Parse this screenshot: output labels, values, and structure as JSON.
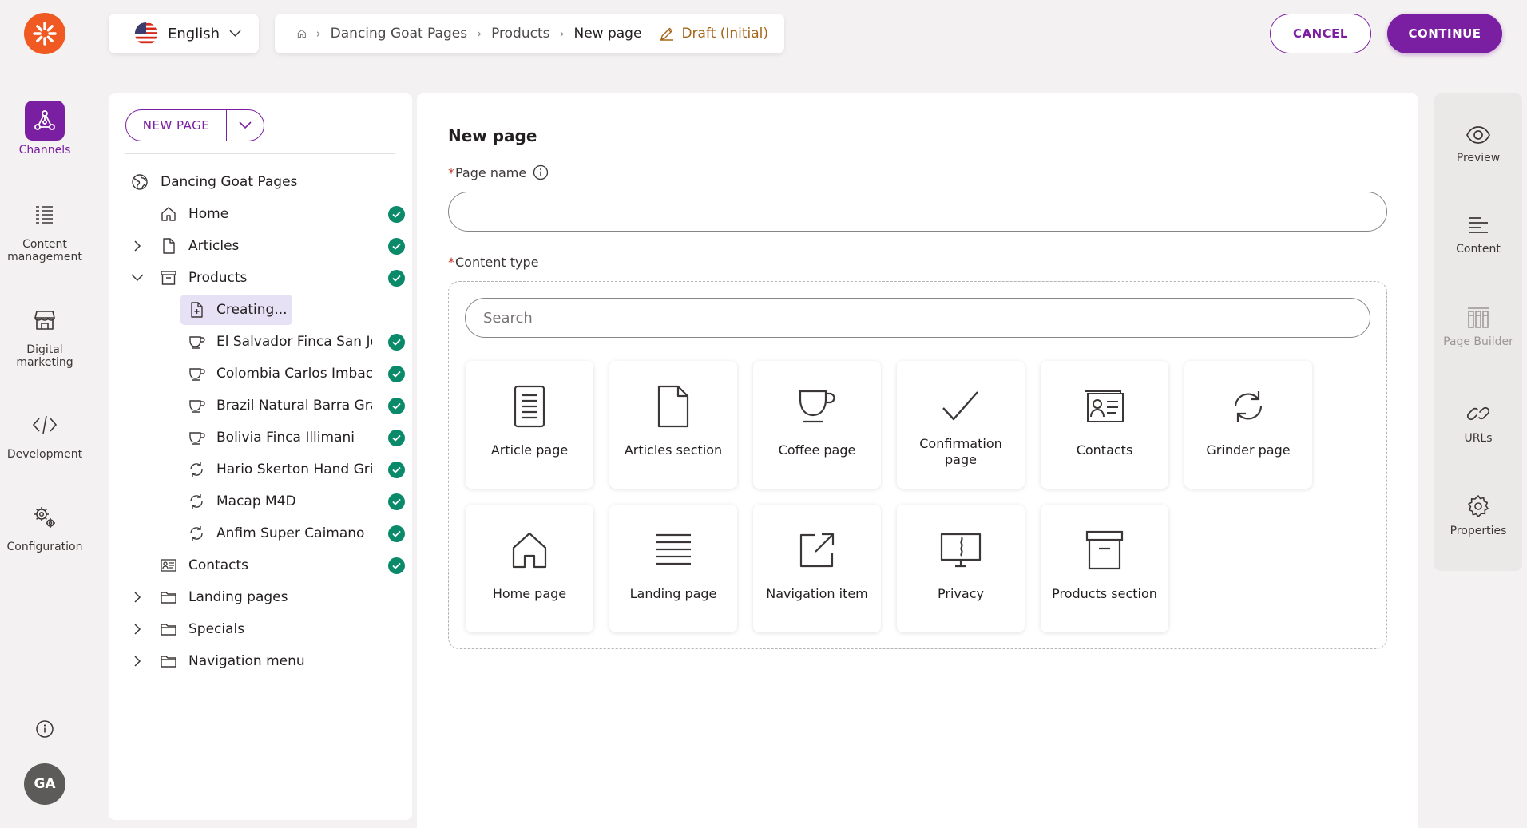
{
  "topbar": {
    "language": "English",
    "breadcrumb": [
      "Dancing Goat Pages",
      "Products",
      "New page"
    ],
    "status": "Draft (Initial)",
    "cancel_label": "CANCEL",
    "continue_label": "CONTINUE"
  },
  "left_rail": {
    "items": [
      {
        "label": "Channels",
        "icon": "channels-icon",
        "active": true
      },
      {
        "label": "Content management",
        "icon": "content-management-icon"
      },
      {
        "label": "Digital marketing",
        "icon": "storefront-icon"
      },
      {
        "label": "Development",
        "icon": "code-icon"
      },
      {
        "label": "Configuration",
        "icon": "gears-icon"
      }
    ],
    "avatar": "GA"
  },
  "tree": {
    "new_page_label": "NEW PAGE",
    "items": [
      {
        "label": "Dancing Goat Pages",
        "icon": "globe-icon"
      },
      {
        "label": "Home",
        "icon": "house-icon",
        "published": true
      },
      {
        "label": "Articles",
        "icon": "doc-icon",
        "published": true,
        "expandable": "collapsed"
      },
      {
        "label": "Products",
        "icon": "archive-icon",
        "published": true,
        "expandable": "expanded"
      },
      {
        "label": "Creating...",
        "icon": "doc-new-icon",
        "selected": true
      },
      {
        "label": "El Salvador Finca San Jose",
        "icon": "cup-icon",
        "published": true
      },
      {
        "label": "Colombia Carlos Imbachi",
        "icon": "cup-icon",
        "published": true
      },
      {
        "label": "Brazil Natural Barra Grande",
        "icon": "cup-icon",
        "published": true
      },
      {
        "label": "Bolivia Finca Illimani",
        "icon": "cup-icon",
        "published": true
      },
      {
        "label": "Hario Skerton Hand Grinder",
        "icon": "rotate-icon",
        "published": true
      },
      {
        "label": "Macap M4D",
        "icon": "rotate-icon",
        "published": true
      },
      {
        "label": "Anfim Super Caimano",
        "icon": "rotate-icon",
        "published": true
      },
      {
        "label": "Contacts",
        "icon": "contacts-icon",
        "published": true
      },
      {
        "label": "Landing pages",
        "icon": "folder-icon",
        "expandable": "collapsed"
      },
      {
        "label": "Specials",
        "icon": "folder-icon",
        "expandable": "collapsed"
      },
      {
        "label": "Navigation menu",
        "icon": "folder-icon",
        "expandable": "collapsed"
      }
    ]
  },
  "form": {
    "title": "New page",
    "page_name_label": "Page name",
    "page_name_value": "",
    "content_type_label": "Content type",
    "search_placeholder": "Search",
    "content_types": [
      {
        "label": "Article page",
        "icon": "article-icon"
      },
      {
        "label": "Articles section",
        "icon": "doc-icon"
      },
      {
        "label": "Coffee page",
        "icon": "cup-icon"
      },
      {
        "label": "Confirmation page",
        "icon": "check-icon"
      },
      {
        "label": "Contacts",
        "icon": "contacts-icon"
      },
      {
        "label": "Grinder page",
        "icon": "rotate-icon"
      },
      {
        "label": "Home page",
        "icon": "house-icon"
      },
      {
        "label": "Landing page",
        "icon": "lines-icon"
      },
      {
        "label": "Navigation item",
        "icon": "external-link-icon"
      },
      {
        "label": "Privacy",
        "icon": "monitor-icon"
      },
      {
        "label": "Products section",
        "icon": "archive-icon"
      }
    ]
  },
  "right_rail": {
    "items": [
      {
        "label": "Preview",
        "icon": "eye-icon"
      },
      {
        "label": "Content",
        "icon": "text-align-icon"
      },
      {
        "label": "Page Builder",
        "icon": "page-builder-icon",
        "disabled": true
      },
      {
        "label": "URLs",
        "icon": "link-icon"
      },
      {
        "label": "Properties",
        "icon": "gear-icon"
      }
    ]
  },
  "colors": {
    "brand_purple": "#7b1fa2",
    "logo_orange": "#f05a22",
    "published_green": "#0b8a6a",
    "draft_amber": "#a5661a"
  }
}
